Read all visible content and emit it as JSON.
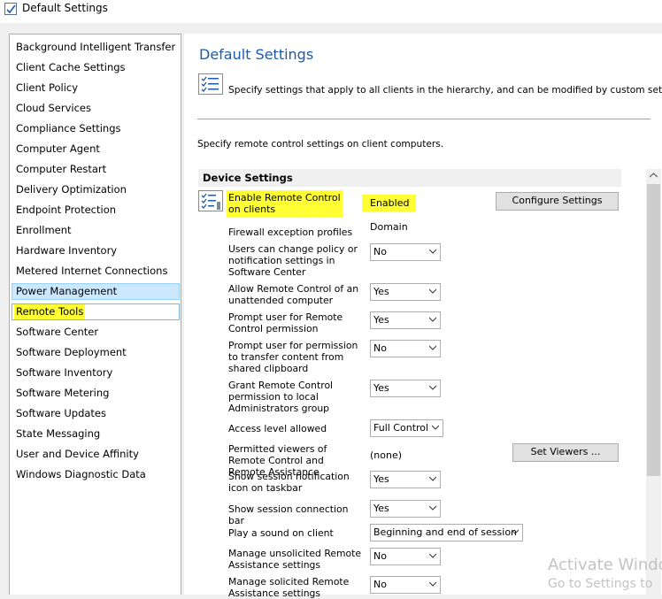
{
  "window": {
    "title": "Default Settings"
  },
  "sidebar": {
    "items": [
      {
        "label": "Background Intelligent Transfer"
      },
      {
        "label": "Client Cache Settings"
      },
      {
        "label": "Client Policy"
      },
      {
        "label": "Cloud Services"
      },
      {
        "label": "Compliance Settings"
      },
      {
        "label": "Computer Agent"
      },
      {
        "label": "Computer Restart"
      },
      {
        "label": "Delivery Optimization"
      },
      {
        "label": "Endpoint Protection"
      },
      {
        "label": "Enrollment"
      },
      {
        "label": "Hardware Inventory"
      },
      {
        "label": "Metered Internet Connections"
      },
      {
        "label": "Power Management"
      },
      {
        "label": "Remote Tools"
      },
      {
        "label": "Software Center"
      },
      {
        "label": "Software Deployment"
      },
      {
        "label": "Software Inventory"
      },
      {
        "label": "Software Metering"
      },
      {
        "label": "Software Updates"
      },
      {
        "label": "State Messaging"
      },
      {
        "label": "User and Device Affinity"
      },
      {
        "label": "Windows Diagnostic Data"
      }
    ]
  },
  "main": {
    "title": "Default Settings",
    "description": "Specify settings that apply to all clients in the hierarchy, and can be modified by custom settings.",
    "sub_description": "Specify remote control settings on client computers.",
    "group_title": "Device Settings",
    "enable": {
      "label": "Enable Remote Control on clients",
      "value": "Enabled",
      "button": "Configure Settings"
    },
    "settings": [
      {
        "label": "Firewall exception profiles",
        "value": "Domain"
      },
      {
        "label": "Users can change policy or notification settings in Software Center",
        "value": "No"
      },
      {
        "label": "Allow Remote Control of an unattended computer",
        "value": "Yes"
      },
      {
        "label": "Prompt user for Remote Control permission",
        "value": "Yes"
      },
      {
        "label": "Prompt user for permission to transfer content from shared clipboard",
        "value": "No"
      },
      {
        "label": "Grant Remote Control permission to local Administrators group",
        "value": "Yes"
      },
      {
        "label": "Access level allowed",
        "value": "Full Control"
      },
      {
        "label": "Permitted viewers of Remote Control and Remote Assistance",
        "value": "(none)",
        "button": "Set Viewers ..."
      },
      {
        "label": "Show session notification icon on taskbar",
        "value": "Yes"
      },
      {
        "label": "Show session connection bar",
        "value": "Yes"
      },
      {
        "label": "Play a sound on client",
        "value": "Beginning and end of session"
      },
      {
        "label": "Manage unsolicited Remote Assistance settings",
        "value": "No"
      },
      {
        "label": "Manage solicited Remote Assistance settings",
        "value": "No"
      }
    ]
  },
  "watermark": {
    "line1": "Activate Windo",
    "line2": "Go to Settings to"
  }
}
